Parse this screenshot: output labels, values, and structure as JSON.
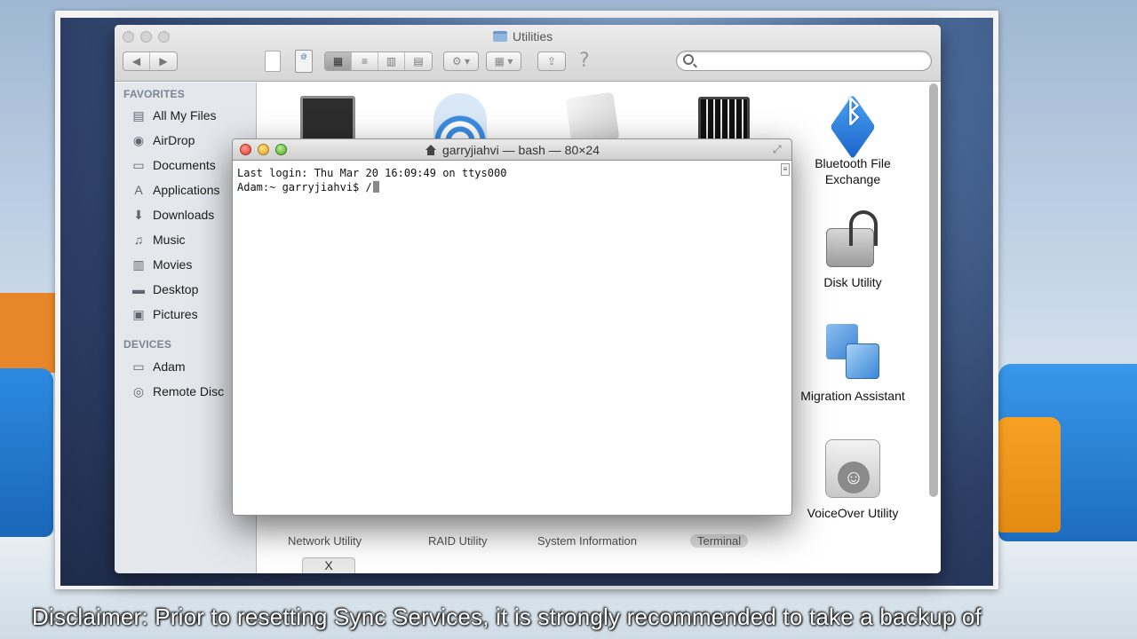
{
  "finder": {
    "title": "Utilities",
    "sidebar": {
      "favorites_heading": "FAVORITES",
      "favorites": [
        {
          "label": "All My Files",
          "icon": "all-files-icon"
        },
        {
          "label": "AirDrop",
          "icon": "airdrop-icon"
        },
        {
          "label": "Documents",
          "icon": "documents-icon"
        },
        {
          "label": "Applications",
          "icon": "applications-icon"
        },
        {
          "label": "Downloads",
          "icon": "downloads-icon"
        },
        {
          "label": "Music",
          "icon": "music-icon"
        },
        {
          "label": "Movies",
          "icon": "movies-icon"
        },
        {
          "label": "Desktop",
          "icon": "desktop-icon"
        },
        {
          "label": "Pictures",
          "icon": "pictures-icon"
        }
      ],
      "devices_heading": "DEVICES",
      "devices": [
        {
          "label": "Adam",
          "icon": "hard-drive-icon"
        },
        {
          "label": "Remote Disc",
          "icon": "remote-disc-icon"
        }
      ]
    },
    "apps": {
      "bluetooth": "Bluetooth File\nExchange",
      "disk_utility": "Disk Utility",
      "migration": "Migration Assistant",
      "voiceover": "VoiceOver Utility",
      "network_utility": "Network Utility",
      "raid_utility": "RAID Utility",
      "system_information": "System Information",
      "terminal": "Terminal"
    }
  },
  "terminal": {
    "title": "garryjiahvi — bash — 80×24",
    "line1": "Last login: Thu Mar 20 16:09:49 on ttys000",
    "line2": "Adam:~ garryjiahvi$ /"
  },
  "disclaimer": "Disclaimer: Prior to resetting Sync Services, it is strongly recommended to take a backup of",
  "colors": {
    "accent_blue": "#3c8de3",
    "close_red": "#d83b2c",
    "minimize_yellow": "#dfa21a",
    "zoom_green": "#4fa82c"
  }
}
